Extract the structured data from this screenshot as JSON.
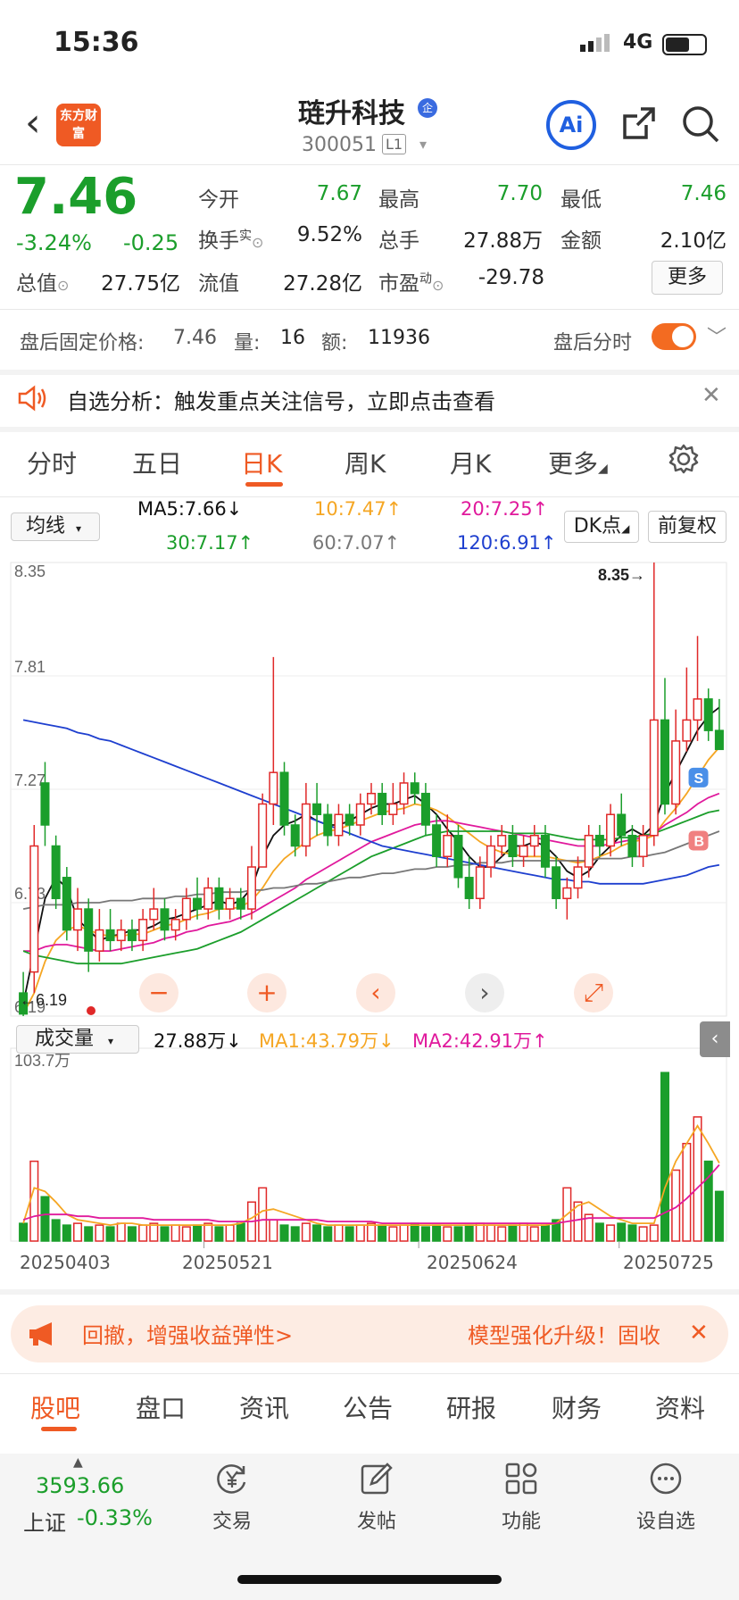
{
  "status": {
    "time": "15:36",
    "network": "4G"
  },
  "header": {
    "logo_text": "东方财富",
    "stock_name": "琏升科技",
    "enterprise_badge": "企",
    "stock_code": "300051",
    "level": "L1",
    "ai_label": "Ai"
  },
  "quote": {
    "price": "7.46",
    "change_pct": "-3.24%",
    "change_val": "-0.25",
    "open_label": "今开",
    "open_val": "7.67",
    "high_label": "最高",
    "high_val": "7.70",
    "low_label": "最低",
    "low_val": "7.46",
    "turnover_label": "换手",
    "turnover_sup": "实",
    "turnover_val": "9.52%",
    "volume_label": "总手",
    "volume_val": "27.88万",
    "amount_label": "金额",
    "amount_val": "2.10亿",
    "mktcap_label": "总值",
    "mktcap_val": "27.75亿",
    "float_label": "流值",
    "float_val": "27.28亿",
    "pe_label": "市盈",
    "pe_sup": "动",
    "pe_val": "-29.78",
    "more_label": "更多"
  },
  "after_hours": {
    "price_label": "盘后固定价格:",
    "price_val": "7.46",
    "qty_label": "量:",
    "qty_val": "16",
    "amt_label": "额:",
    "amt_val": "11936",
    "intraday_label": "盘后分时",
    "toggle_on": true
  },
  "alert": {
    "text": "自选分析：触发重点关注信号，立即点击查看"
  },
  "tabs": [
    "分时",
    "五日",
    "日K",
    "周K",
    "月K",
    "更多"
  ],
  "active_tab": "日K",
  "ma_bar": {
    "select_label": "均线",
    "ma5": "MA5:7.66↓",
    "ma10": "10:7.47↑",
    "ma20": "20:7.25↑",
    "ma30": "30:7.17↑",
    "ma60": "60:7.07↑",
    "ma120": "120:6.91↑",
    "dk_label": "DK点",
    "adj_label": "前复权"
  },
  "volume_bar": {
    "select_label": "成交量",
    "vol": "27.88万↓",
    "ma1": "MA1:43.79万↓",
    "ma2": "MA2:42.91万↑"
  },
  "colors": {
    "up": "#e02828",
    "down": "#1b9e2b",
    "accent": "#ef5a24"
  },
  "chart_data": {
    "type": "candlestick",
    "ylim": [
      6.19,
      8.35
    ],
    "y_ticks": [
      "8.35",
      "7.81",
      "7.27",
      "6.73",
      "6.19"
    ],
    "high_marker": "8.35→",
    "low_marker": "←6.19",
    "volume_max": "103.7万",
    "x_labels": [
      "20250403",
      "20250521",
      "20250624",
      "20250725"
    ],
    "signals": {
      "sell": "S",
      "buy": "B"
    },
    "candles": [
      {
        "o": 6.3,
        "c": 6.2,
        "h": 6.4,
        "l": 6.19
      },
      {
        "o": 6.4,
        "c": 7.0,
        "h": 7.1,
        "l": 6.3
      },
      {
        "o": 7.3,
        "c": 7.1,
        "h": 7.4,
        "l": 7.0
      },
      {
        "o": 7.0,
        "c": 6.75,
        "h": 7.05,
        "l": 6.7
      },
      {
        "o": 6.85,
        "c": 6.6,
        "h": 6.9,
        "l": 6.55
      },
      {
        "o": 6.6,
        "c": 6.7,
        "h": 6.8,
        "l": 6.5
      },
      {
        "o": 6.7,
        "c": 6.5,
        "h": 6.75,
        "l": 6.4
      },
      {
        "o": 6.5,
        "c": 6.6,
        "h": 6.7,
        "l": 6.45
      },
      {
        "o": 6.6,
        "c": 6.55,
        "h": 6.7,
        "l": 6.5
      },
      {
        "o": 6.55,
        "c": 6.6,
        "h": 6.65,
        "l": 6.5
      },
      {
        "o": 6.6,
        "c": 6.55,
        "h": 6.65,
        "l": 6.5
      },
      {
        "o": 6.55,
        "c": 6.65,
        "h": 6.7,
        "l": 6.5
      },
      {
        "o": 6.65,
        "c": 6.7,
        "h": 6.8,
        "l": 6.6
      },
      {
        "o": 6.7,
        "c": 6.6,
        "h": 6.75,
        "l": 6.55
      },
      {
        "o": 6.6,
        "c": 6.65,
        "h": 6.7,
        "l": 6.55
      },
      {
        "o": 6.65,
        "c": 6.75,
        "h": 6.8,
        "l": 6.6
      },
      {
        "o": 6.75,
        "c": 6.7,
        "h": 6.85,
        "l": 6.65
      },
      {
        "o": 6.7,
        "c": 6.8,
        "h": 6.85,
        "l": 6.65
      },
      {
        "o": 6.8,
        "c": 6.7,
        "h": 6.85,
        "l": 6.65
      },
      {
        "o": 6.7,
        "c": 6.75,
        "h": 6.8,
        "l": 6.65
      },
      {
        "o": 6.75,
        "c": 6.7,
        "h": 6.8,
        "l": 6.65
      },
      {
        "o": 6.7,
        "c": 6.9,
        "h": 7.0,
        "l": 6.65
      },
      {
        "o": 6.9,
        "c": 7.2,
        "h": 7.25,
        "l": 6.9
      },
      {
        "o": 7.2,
        "c": 7.35,
        "h": 7.9,
        "l": 7.1
      },
      {
        "o": 7.35,
        "c": 7.1,
        "h": 7.4,
        "l": 7.05
      },
      {
        "o": 7.1,
        "c": 7.0,
        "h": 7.15,
        "l": 6.95
      },
      {
        "o": 7.0,
        "c": 7.2,
        "h": 7.3,
        "l": 6.95
      },
      {
        "o": 7.2,
        "c": 7.15,
        "h": 7.3,
        "l": 7.05
      },
      {
        "o": 7.15,
        "c": 7.05,
        "h": 7.2,
        "l": 7.0
      },
      {
        "o": 7.05,
        "c": 7.15,
        "h": 7.2,
        "l": 7.0
      },
      {
        "o": 7.15,
        "c": 7.1,
        "h": 7.2,
        "l": 7.05
      },
      {
        "o": 7.1,
        "c": 7.2,
        "h": 7.25,
        "l": 7.05
      },
      {
        "o": 7.2,
        "c": 7.25,
        "h": 7.3,
        "l": 7.15
      },
      {
        "o": 7.25,
        "c": 7.15,
        "h": 7.3,
        "l": 7.1
      },
      {
        "o": 7.15,
        "c": 7.2,
        "h": 7.3,
        "l": 7.1
      },
      {
        "o": 7.2,
        "c": 7.3,
        "h": 7.35,
        "l": 7.15
      },
      {
        "o": 7.3,
        "c": 7.25,
        "h": 7.35,
        "l": 7.2
      },
      {
        "o": 7.25,
        "c": 7.1,
        "h": 7.3,
        "l": 7.05
      },
      {
        "o": 7.1,
        "c": 6.95,
        "h": 7.15,
        "l": 6.9
      },
      {
        "o": 6.95,
        "c": 7.05,
        "h": 7.15,
        "l": 6.9
      },
      {
        "o": 7.05,
        "c": 6.85,
        "h": 7.1,
        "l": 6.8
      },
      {
        "o": 6.85,
        "c": 6.75,
        "h": 6.95,
        "l": 6.7
      },
      {
        "o": 6.75,
        "c": 6.9,
        "h": 6.95,
        "l": 6.7
      },
      {
        "o": 6.9,
        "c": 7.0,
        "h": 7.05,
        "l": 6.85
      },
      {
        "o": 7.0,
        "c": 7.05,
        "h": 7.1,
        "l": 6.95
      },
      {
        "o": 7.05,
        "c": 6.95,
        "h": 7.1,
        "l": 6.9
      },
      {
        "o": 6.95,
        "c": 7.0,
        "h": 7.05,
        "l": 6.9
      },
      {
        "o": 7.0,
        "c": 7.05,
        "h": 7.1,
        "l": 6.95
      },
      {
        "o": 7.05,
        "c": 6.9,
        "h": 7.1,
        "l": 6.85
      },
      {
        "o": 6.9,
        "c": 6.75,
        "h": 6.95,
        "l": 6.7
      },
      {
        "o": 6.75,
        "c": 6.8,
        "h": 6.85,
        "l": 6.65
      },
      {
        "o": 6.8,
        "c": 6.9,
        "h": 6.95,
        "l": 6.75
      },
      {
        "o": 6.9,
        "c": 7.05,
        "h": 7.1,
        "l": 6.85
      },
      {
        "o": 7.05,
        "c": 7.0,
        "h": 7.1,
        "l": 6.95
      },
      {
        "o": 7.0,
        "c": 7.15,
        "h": 7.2,
        "l": 6.95
      },
      {
        "o": 7.15,
        "c": 7.05,
        "h": 7.25,
        "l": 7.0
      },
      {
        "o": 7.05,
        "c": 6.95,
        "h": 7.1,
        "l": 6.9
      },
      {
        "o": 6.95,
        "c": 7.05,
        "h": 7.1,
        "l": 6.9
      },
      {
        "o": 7.05,
        "c": 7.6,
        "h": 8.35,
        "l": 7.0
      },
      {
        "o": 7.6,
        "c": 7.2,
        "h": 7.8,
        "l": 7.15
      },
      {
        "o": 7.2,
        "c": 7.5,
        "h": 7.65,
        "l": 7.15
      },
      {
        "o": 7.5,
        "c": 7.6,
        "h": 7.85,
        "l": 7.45
      },
      {
        "o": 7.6,
        "c": 7.7,
        "h": 8.0,
        "l": 7.5
      },
      {
        "o": 7.7,
        "c": 7.55,
        "h": 7.75,
        "l": 7.5
      },
      {
        "o": 7.55,
        "c": 7.46,
        "h": 7.7,
        "l": 7.46
      }
    ],
    "volumes": [
      10,
      45,
      25,
      12,
      9,
      10,
      8,
      9,
      8,
      10,
      8,
      9,
      10,
      8,
      9,
      8,
      9,
      10,
      8,
      9,
      10,
      22,
      30,
      12,
      9,
      8,
      10,
      9,
      8,
      9,
      8,
      9,
      10,
      9,
      8,
      9,
      10,
      8,
      9,
      8,
      8,
      9,
      10,
      9,
      8,
      9,
      10,
      8,
      9,
      12,
      30,
      22,
      15,
      10,
      9,
      10,
      9,
      8,
      9,
      95,
      40,
      55,
      70,
      45,
      28
    ],
    "ma_series": {
      "ma5": [
        6.25,
        6.5,
        6.75,
        6.85,
        6.8,
        6.65,
        6.6,
        6.55,
        6.57,
        6.58,
        6.6,
        6.6,
        6.62,
        6.65,
        6.66,
        6.68,
        6.7,
        6.72,
        6.74,
        6.72,
        6.74,
        6.8,
        6.95,
        7.05,
        7.1,
        7.12,
        7.15,
        7.12,
        7.1,
        7.1,
        7.12,
        7.15,
        7.18,
        7.2,
        7.2,
        7.22,
        7.24,
        7.2,
        7.15,
        7.08,
        7.02,
        6.95,
        6.9,
        6.9,
        6.95,
        7.0,
        7.0,
        7.02,
        7.0,
        6.95,
        6.88,
        6.85,
        6.88,
        6.95,
        7.0,
        7.05,
        7.08,
        7.05,
        7.1,
        7.25,
        7.35,
        7.45,
        7.55,
        7.62,
        7.66
      ],
      "ma10": [
        6.2,
        6.3,
        6.45,
        6.55,
        6.6,
        6.62,
        6.6,
        6.58,
        6.57,
        6.57,
        6.58,
        6.58,
        6.6,
        6.62,
        6.63,
        6.65,
        6.67,
        6.68,
        6.7,
        6.7,
        6.71,
        6.74,
        6.8,
        6.88,
        6.94,
        6.98,
        7.02,
        7.05,
        7.07,
        7.08,
        7.1,
        7.12,
        7.14,
        7.16,
        7.17,
        7.18,
        7.2,
        7.19,
        7.17,
        7.14,
        7.1,
        7.06,
        7.02,
        6.99,
        6.97,
        6.96,
        6.95,
        6.95,
        6.95,
        6.94,
        6.93,
        6.92,
        6.93,
        6.95,
        6.97,
        7.0,
        7.02,
        7.03,
        7.05,
        7.12,
        7.18,
        7.25,
        7.33,
        7.41,
        7.47
      ],
      "ma20": [
        6.5,
        6.5,
        6.52,
        6.53,
        6.53,
        6.52,
        6.51,
        6.5,
        6.5,
        6.51,
        6.52,
        6.53,
        6.54,
        6.56,
        6.57,
        6.59,
        6.6,
        6.62,
        6.63,
        6.64,
        6.66,
        6.68,
        6.71,
        6.74,
        6.77,
        6.8,
        6.84,
        6.87,
        6.9,
        6.93,
        6.96,
        6.99,
        7.02,
        7.04,
        7.06,
        7.08,
        7.1,
        7.11,
        7.12,
        7.12,
        7.11,
        7.1,
        7.09,
        7.08,
        7.07,
        7.06,
        7.05,
        7.04,
        7.03,
        7.02,
        7.01,
        7.0,
        7.0,
        7.0,
        7.01,
        7.02,
        7.03,
        7.04,
        7.06,
        7.1,
        7.13,
        7.16,
        7.2,
        7.23,
        7.25
      ],
      "ma30": [
        6.5,
        6.48,
        6.47,
        6.46,
        6.45,
        6.44,
        6.44,
        6.44,
        6.44,
        6.44,
        6.45,
        6.46,
        6.47,
        6.48,
        6.49,
        6.5,
        6.51,
        6.53,
        6.55,
        6.57,
        6.59,
        6.62,
        6.65,
        6.68,
        6.71,
        6.74,
        6.77,
        6.8,
        6.83,
        6.86,
        6.89,
        6.92,
        6.95,
        6.97,
        6.99,
        7.01,
        7.03,
        7.05,
        7.06,
        7.07,
        7.07,
        7.07,
        7.07,
        7.07,
        7.07,
        7.06,
        7.06,
        7.06,
        7.06,
        7.05,
        7.04,
        7.03,
        7.03,
        7.03,
        7.03,
        7.04,
        7.04,
        7.05,
        7.06,
        7.08,
        7.1,
        7.12,
        7.14,
        7.16,
        7.17
      ],
      "ma60": [
        6.7,
        6.71,
        6.72,
        6.72,
        6.72,
        6.73,
        6.73,
        6.73,
        6.74,
        6.74,
        6.74,
        6.75,
        6.75,
        6.75,
        6.76,
        6.76,
        6.77,
        6.77,
        6.78,
        6.78,
        6.78,
        6.79,
        6.79,
        6.8,
        6.8,
        6.81,
        6.82,
        6.82,
        6.83,
        6.84,
        6.85,
        6.85,
        6.86,
        6.87,
        6.87,
        6.88,
        6.89,
        6.89,
        6.9,
        6.9,
        6.91,
        6.91,
        6.92,
        6.92,
        6.92,
        6.93,
        6.93,
        6.93,
        6.93,
        6.93,
        6.93,
        6.93,
        6.93,
        6.94,
        6.94,
        6.94,
        6.95,
        6.95,
        6.96,
        6.97,
        6.99,
        7.01,
        7.03,
        7.05,
        7.07
      ],
      "ma120": [
        7.6,
        7.59,
        7.58,
        7.57,
        7.56,
        7.54,
        7.53,
        7.51,
        7.5,
        7.48,
        7.46,
        7.44,
        7.42,
        7.4,
        7.38,
        7.36,
        7.34,
        7.32,
        7.3,
        7.28,
        7.26,
        7.24,
        7.22,
        7.2,
        7.18,
        7.16,
        7.14,
        7.12,
        7.1,
        7.08,
        7.06,
        7.04,
        7.02,
        7.0,
        6.99,
        6.98,
        6.97,
        6.96,
        6.95,
        6.94,
        6.93,
        6.92,
        6.91,
        6.9,
        6.89,
        6.88,
        6.87,
        6.86,
        6.85,
        6.84,
        6.84,
        6.83,
        6.83,
        6.82,
        6.82,
        6.82,
        6.82,
        6.82,
        6.83,
        6.84,
        6.85,
        6.86,
        6.88,
        6.9,
        6.91
      ]
    },
    "vol_ma1": [
      10,
      30,
      28,
      22,
      15,
      12,
      11,
      10,
      9,
      10,
      10,
      9,
      9,
      9,
      9,
      9,
      9,
      9,
      9,
      9,
      10,
      13,
      17,
      18,
      16,
      14,
      12,
      10,
      9,
      9,
      9,
      9,
      9,
      9,
      9,
      9,
      9,
      9,
      9,
      9,
      9,
      9,
      9,
      9,
      9,
      9,
      9,
      9,
      9,
      10,
      15,
      20,
      22,
      18,
      14,
      12,
      10,
      10,
      10,
      30,
      45,
      55,
      65,
      55,
      44
    ],
    "vol_ma2": [
      12,
      14,
      15,
      15,
      15,
      14,
      14,
      13,
      13,
      13,
      13,
      13,
      12,
      12,
      12,
      12,
      12,
      12,
      11,
      11,
      11,
      11,
      12,
      12,
      12,
      12,
      12,
      12,
      11,
      11,
      11,
      11,
      11,
      10,
      10,
      10,
      10,
      10,
      10,
      10,
      10,
      10,
      10,
      10,
      10,
      10,
      10,
      10,
      10,
      10,
      11,
      12,
      13,
      13,
      13,
      13,
      13,
      13,
      13,
      16,
      19,
      24,
      30,
      36,
      43
    ]
  },
  "chart_buttons": {
    "minus": "−",
    "plus": "+",
    "prev": "‹",
    "next": "›",
    "expand": "⤢"
  },
  "promo": {
    "left": "回撤，增强收益弹性>",
    "right": "模型强化升级！固收"
  },
  "bottom_tabs": [
    "股吧",
    "盘口",
    "资讯",
    "公告",
    "研报",
    "财务",
    "资料"
  ],
  "bottom_bar": {
    "index_val": "3593.66",
    "index_name": "上证",
    "index_chg": "-0.33%",
    "nav": [
      "交易",
      "发帖",
      "功能",
      "设自选"
    ]
  }
}
